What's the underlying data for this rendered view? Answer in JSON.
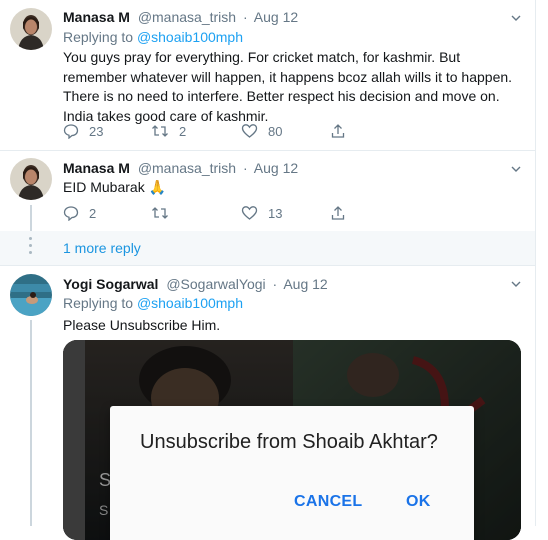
{
  "tweets": [
    {
      "display_name": "Manasa M",
      "handle": "@manasa_trish",
      "separator": "·",
      "date": "Aug 12",
      "replying_prefix": "Replying to",
      "replying_handle": "@shoaib100mph",
      "text": "You guys pray for everything. For cricket match, for kashmir. But remember whatever will happen, it happens bcoz allah wills it to happen. There is no need to interfere. Better respect his decision and move on. India takes good care of kashmir.",
      "replies": "23",
      "retweets": "2",
      "likes": "80"
    },
    {
      "display_name": "Manasa M",
      "handle": "@manasa_trish",
      "separator": "·",
      "date": "Aug 12",
      "text": "EID Mubarak 🙏",
      "replies": "2",
      "retweets": "",
      "likes": "13"
    },
    {
      "display_name": "Yogi Sogarwal",
      "handle": "@SogarwalYogi",
      "separator": "·",
      "date": "Aug 12",
      "replying_prefix": "Replying to",
      "replying_handle": "@shoaib100mph",
      "text": "Please Unsubscribe Him."
    }
  ],
  "more_replies_label": "1 more reply",
  "media": {
    "dialog_title": "Unsubscribe from Shoaib Akhtar?",
    "cancel_label": "CANCEL",
    "ok_label": "OK",
    "partial_letters": [
      "S",
      "S"
    ]
  },
  "colors": {
    "link": "#1da1f2",
    "muted": "#657786",
    "dialog_button": "#1a73e8"
  }
}
